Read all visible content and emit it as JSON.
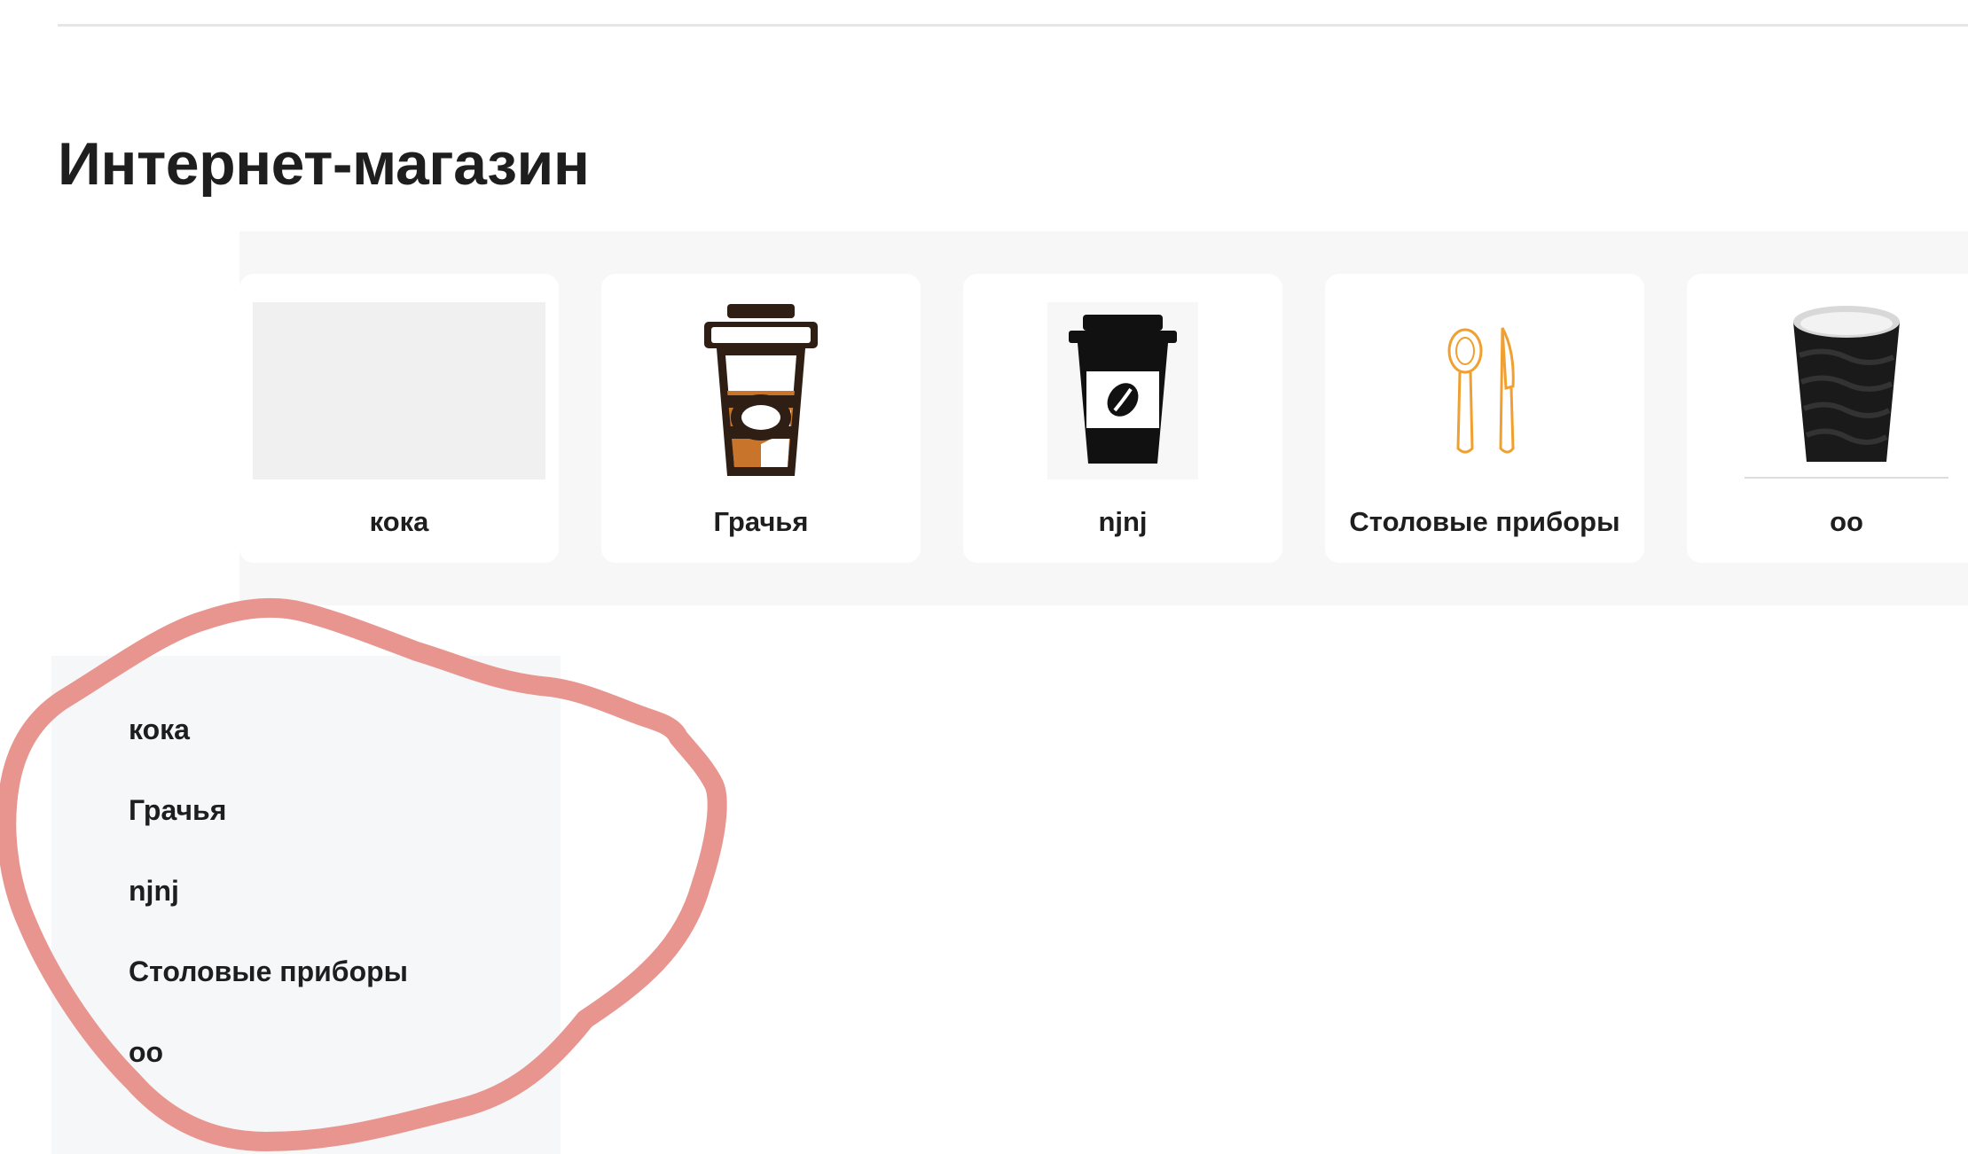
{
  "page": {
    "title": "Интернет-магазин"
  },
  "categories": [
    {
      "label": "кока",
      "image": "image-placeholder"
    },
    {
      "label": "Грачья",
      "image": "coffee-cup-icon"
    },
    {
      "label": "njnj",
      "image": "coffee-cup-icon"
    },
    {
      "label": "Столовые приборы",
      "image": "cutlery-icon"
    },
    {
      "label": "оо",
      "image": "paper-cup-icon"
    }
  ],
  "sidebar": {
    "items": [
      {
        "label": "кока"
      },
      {
        "label": "Грачья"
      },
      {
        "label": "njnj"
      },
      {
        "label": "Столовые приборы"
      },
      {
        "label": "оо"
      }
    ]
  },
  "colors": {
    "annotation": "#e8958f",
    "cup_brown": "#2e1e14",
    "cup_orange": "#c8742a",
    "cutlery_orange": "#f0a030"
  }
}
